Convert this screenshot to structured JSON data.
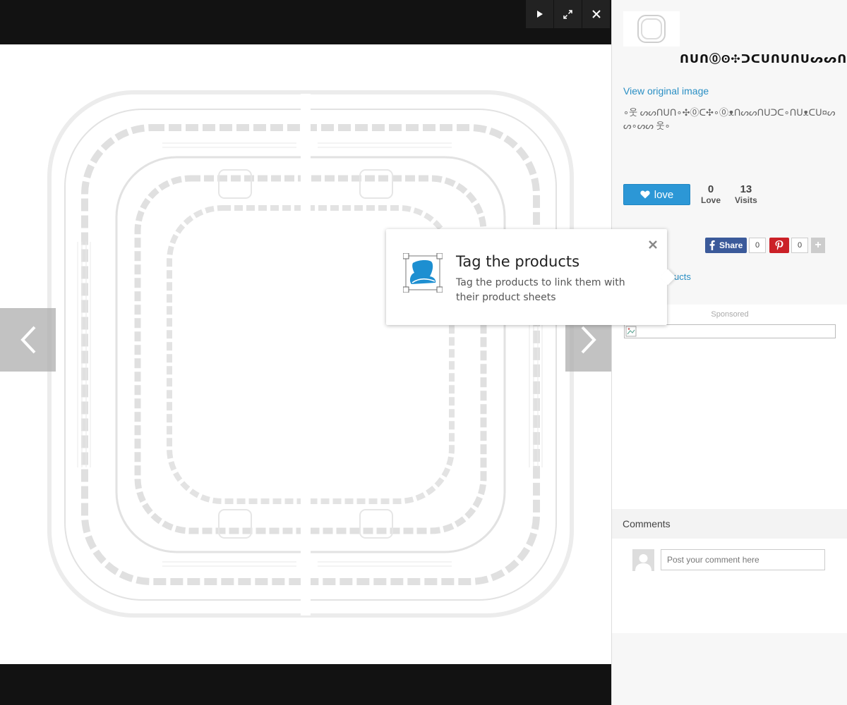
{
  "viewer": {
    "toolbar": {
      "play_icon": "play-icon",
      "fullscreen_icon": "expand-icon",
      "close_icon": "close-icon"
    },
    "prev_icon": "chevron-left-icon",
    "next_icon": "chevron-right-icon"
  },
  "tooltip": {
    "title": "Tag the products",
    "body": "Tag the products to link them with their product sheets",
    "icon": "chair-tag-icon",
    "accent_color": "#1d8fd1"
  },
  "sidebar": {
    "author_name": "ᑎᑌᑎ⓪ʘ✣ᑐᑕᑌᑎᑌᑎᑌᔕᔕᑎ",
    "view_original_label": "View original image",
    "description": "∘웃 ᔕᔕᑎᑌᑎ∘✣⓪ᑕ✣∘⓪ᴥᑎᔕᔕᑎᑌᑐᑕ∘ᑎᑌᴥᑕᑌ¤ᔕᔕ∘ᔕᔕ 웃∘",
    "love_button_label": "love",
    "stats": {
      "love_count": "0",
      "love_label": "Love",
      "visits_count": "13",
      "visits_label": "Visits"
    },
    "share": {
      "facebook_label": "Share",
      "facebook_count": "0",
      "pinterest_count": "0",
      "more_label": "+"
    },
    "products_link": "ucts",
    "sponsored_label": "Sponsored",
    "comments_title": "Comments",
    "comment_placeholder": "Post your comment here",
    "brand_color": "#2c97d6"
  }
}
